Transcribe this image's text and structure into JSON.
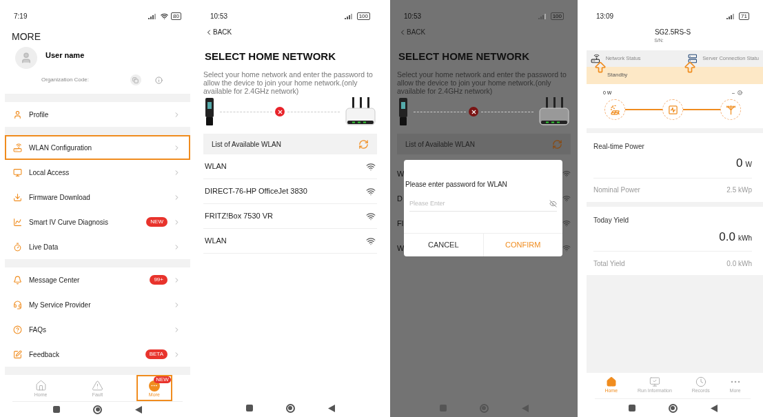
{
  "more_screen": {
    "status_bar": {
      "time": "7:19",
      "battery": "80"
    },
    "title": "MORE",
    "user": {
      "name": "User name",
      "org_label": "Organization Code:"
    },
    "groups": [
      [
        {
          "label": "Profile",
          "highlighted": false
        }
      ],
      [
        {
          "label": "WLAN Configuration",
          "highlighted": true
        },
        {
          "label": "Local Access",
          "highlighted": false
        },
        {
          "label": "Firmware Download",
          "highlighted": false
        },
        {
          "label": "Smart IV Curve Diagnosis",
          "badge": "NEW",
          "highlighted": false
        },
        {
          "label": "Live Data",
          "highlighted": false
        }
      ],
      [
        {
          "label": "Message Center",
          "badge": "99+",
          "highlighted": false
        },
        {
          "label": "My Service Provider",
          "highlighted": false
        },
        {
          "label": "FAQs",
          "highlighted": false
        },
        {
          "label": "Feedback",
          "badge": "BETA",
          "highlighted": false
        }
      ]
    ],
    "tabs": [
      {
        "label": "Home",
        "selected": false,
        "highlighted": false
      },
      {
        "label": "Fault",
        "selected": false,
        "highlighted": false
      },
      {
        "label": "More",
        "selected": true,
        "badge": "NEW",
        "highlighted": true
      }
    ]
  },
  "wlan_screen": {
    "status_bar": {
      "time": "10:53",
      "battery": "100"
    },
    "back": "BACK",
    "title": "SELECT HOME NETWORK",
    "description": "Select your home network and enter the password to allow the device to join your home network.(only available for 2.4GHz network)",
    "list_header": "List of Available WLAN",
    "networks": [
      {
        "name": "WLAN"
      },
      {
        "name": "DIRECT-76-HP OfficeJet 3830"
      },
      {
        "name": "FRITZ!Box 7530 VR"
      },
      {
        "name": "WLAN"
      }
    ]
  },
  "password_screen": {
    "status_bar": {
      "time": "10:53",
      "battery": "100"
    },
    "back": "BACK",
    "title": "SELECT HOME NETWORK",
    "description": "Select your home network and enter the password to allow the device to join your home network.(only available for 2.4GHz network)",
    "list_header": "List of Available WLAN",
    "networks_visible": [
      {
        "name": "W"
      },
      {
        "name": "D"
      },
      {
        "name": "Fl"
      },
      {
        "name": "W"
      }
    ],
    "dialog": {
      "prompt": "Please enter password for WLAN",
      "placeholder": "Please Enter",
      "cancel": "CANCEL",
      "confirm": "CONFIRM"
    }
  },
  "home_screen": {
    "status_bar": {
      "time": "13:09",
      "battery": "71"
    },
    "device": "SG2.5RS-S",
    "serial_label": "S/N:",
    "network_status": "Network Status",
    "server_status": "Server Connection Statu",
    "state": "Standby",
    "flow": {
      "pv_reading": "0 W",
      "grid_reading": "–"
    },
    "realtime": {
      "label": "Real-time Power",
      "value": "0",
      "unit": "W"
    },
    "nominal": {
      "label": "Nominal Power",
      "value": "2.5 kWp"
    },
    "today": {
      "label": "Today Yield",
      "value": "0.0",
      "unit": "kWh"
    },
    "total": {
      "label": "Total Yield",
      "value": "0.0 kWh"
    },
    "tabs": [
      {
        "label": "Home",
        "selected": true
      },
      {
        "label": "Run Information",
        "selected": false
      },
      {
        "label": "Records",
        "selected": false
      },
      {
        "label": "More",
        "selected": false
      }
    ]
  }
}
